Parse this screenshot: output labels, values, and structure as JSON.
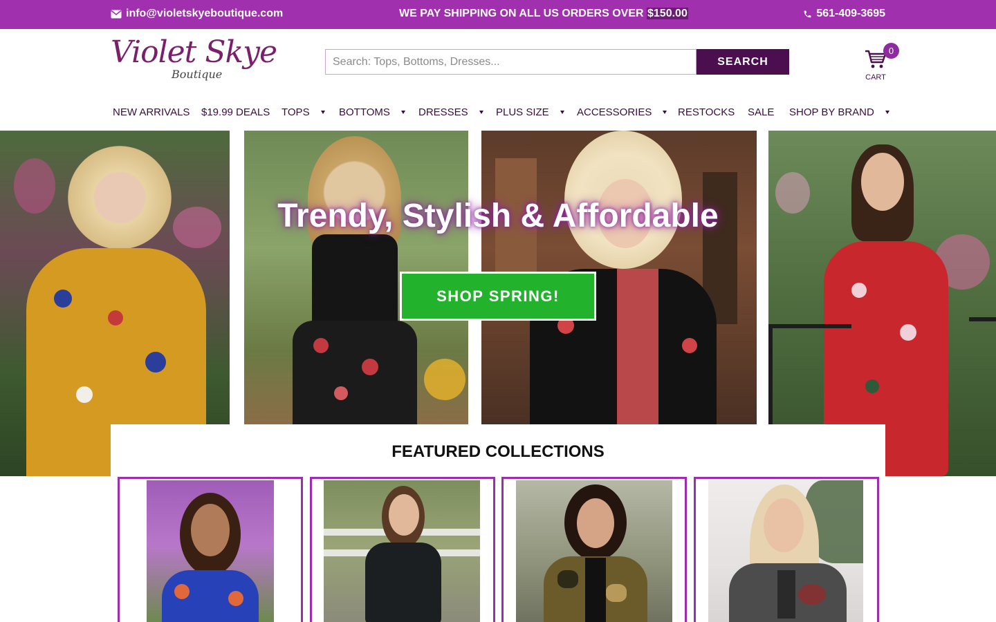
{
  "topbar": {
    "email": "info@violetskyeboutique.com",
    "promo_text": "WE PAY SHIPPING ON ALL US ORDERS OVER ",
    "promo_amount": "$150.00",
    "phone": "561-409-3695"
  },
  "logo": {
    "name": "Violet Skye",
    "sub": "Boutique"
  },
  "search": {
    "placeholder": "Search: Tops, Bottoms, Dresses...",
    "button_label": "SEARCH"
  },
  "cart": {
    "count": "0",
    "label": "CART"
  },
  "nav": {
    "items": [
      {
        "label": "NEW ARRIVALS",
        "dropdown": false
      },
      {
        "label": "$19.99 DEALS",
        "dropdown": false
      },
      {
        "label": "TOPS",
        "dropdown": true
      },
      {
        "label": "BOTTOMS",
        "dropdown": true
      },
      {
        "label": "DRESSES",
        "dropdown": true
      },
      {
        "label": "PLUS SIZE",
        "dropdown": true
      },
      {
        "label": "ACCESSORIES",
        "dropdown": true
      },
      {
        "label": "RESTOCKS",
        "dropdown": false
      },
      {
        "label": "SALE",
        "dropdown": false
      },
      {
        "label": "SHOP BY BRAND",
        "dropdown": true
      }
    ]
  },
  "hero": {
    "title": "Trendy, Stylish & Affordable",
    "cta_label": "SHOP SPRING!"
  },
  "featured": {
    "title": "FEATURED COLLECTIONS"
  },
  "colors": {
    "brand_purple": "#a030ae",
    "dark_purple": "#4b0f4f",
    "cta_green": "#23b22b",
    "card_border": "#9c2db0"
  }
}
